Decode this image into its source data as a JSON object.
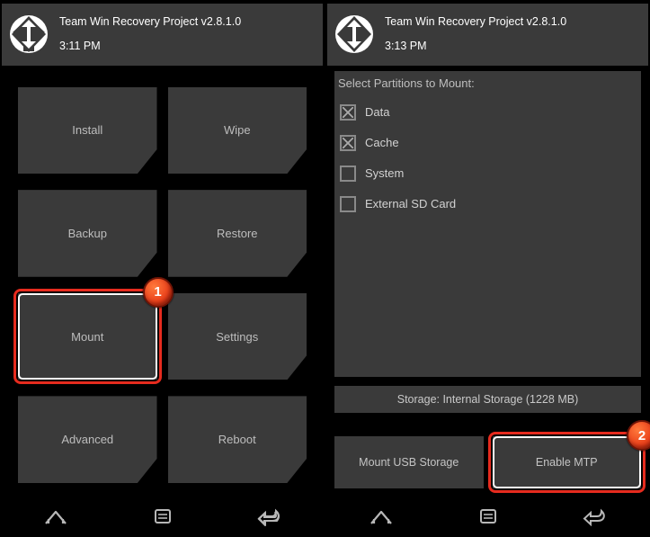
{
  "left": {
    "header": {
      "title": "Team Win Recovery Project  v2.8.1.0",
      "time": "3:11 PM"
    },
    "buttons": [
      "Install",
      "Wipe",
      "Backup",
      "Restore",
      "Mount",
      "Settings",
      "Advanced",
      "Reboot"
    ],
    "highlight_index": 4,
    "badge_number": "1"
  },
  "right": {
    "header": {
      "title": "Team Win Recovery Project  v2.8.1.0",
      "time": "3:13 PM"
    },
    "mount_title": "Select Partitions to Mount:",
    "partitions": [
      {
        "label": "Data",
        "checked": true
      },
      {
        "label": "Cache",
        "checked": true
      },
      {
        "label": "System",
        "checked": false
      },
      {
        "label": "External SD Card",
        "checked": false
      }
    ],
    "storage": "Storage: Internal Storage (1228 MB)",
    "actions": {
      "mount_usb": "Mount USB Storage",
      "enable_mtp": "Enable MTP"
    },
    "badge_number": "2"
  }
}
